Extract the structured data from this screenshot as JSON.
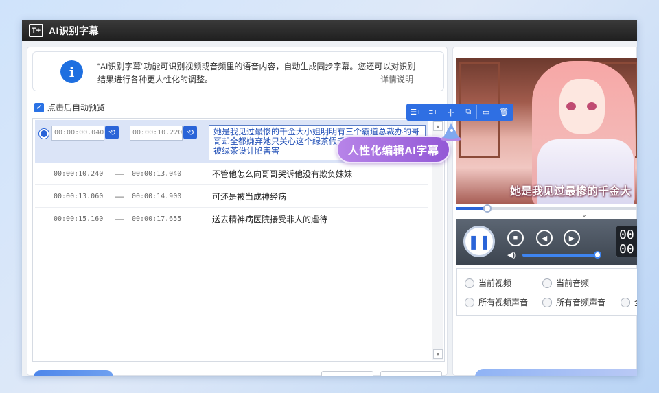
{
  "window": {
    "title": "AI识别字幕",
    "logo_text": "T+"
  },
  "info": {
    "icon": "info-icon",
    "text": "“AI识别字幕”功能可识别视频或音频里的语音内容，自动生成同步字幕。您还可以对识别结果进行各种更人性化的调整。",
    "link": "详情说明"
  },
  "auto_preview": {
    "label": "点击后自动预览",
    "checked": true
  },
  "subtitles": {
    "active": {
      "start": "00:00:00.040",
      "end": "00:00:10.220",
      "text": "她是我见过最惨的千金大小姐明明有三个霸道总裁办的哥哥却全都嫌弃她只关心这个绿茶假千金只因为他天性善良被绿茶设计陷害害"
    },
    "rows": [
      {
        "start": "00:00:10.240",
        "sep": "—",
        "end": "00:00:13.040",
        "text": "不管他怎么向哥哥哭诉他没有欺负妹妹"
      },
      {
        "start": "00:00:13.060",
        "sep": "—",
        "end": "00:00:14.900",
        "text": "可还是被当成神经病"
      },
      {
        "start": "00:00:15.160",
        "sep": "—",
        "end": "00:00:17.655",
        "text": "送去精神病医院接受非人的虐待"
      }
    ]
  },
  "toolbar_icons": [
    "insert-above-icon",
    "insert-below-icon",
    "split-icon",
    "merge-icon",
    "subtitle-style-icon",
    "delete-icon"
  ],
  "promo": {
    "label": "人性化编辑AI字幕"
  },
  "player": {
    "subtitle_overlay": "她是我见过最惨的千金大",
    "progress": 0.17,
    "volume": 0.95,
    "time_display": "00\n00"
  },
  "source_options": [
    {
      "label": "当前视频",
      "selected": false
    },
    {
      "label": "当前音频",
      "selected": false
    },
    {
      "label": "所有视频声音",
      "selected": false
    },
    {
      "label": "所有音频声音",
      "selected": false
    },
    {
      "label": "全",
      "selected": false
    }
  ],
  "colors": {
    "accent": "#2a64d8",
    "promo": "#9358d6",
    "titlebar": "#2b2b2b"
  }
}
